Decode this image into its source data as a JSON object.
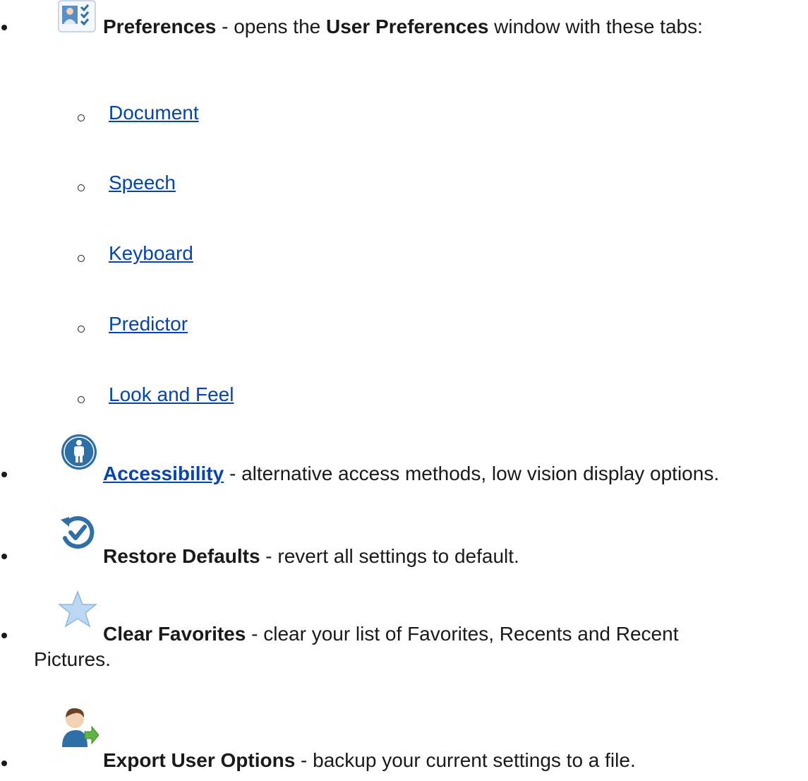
{
  "items": [
    {
      "icon": "preferences-icon",
      "title": "Preferences",
      "sep": " - ",
      "desc_pre": "opens the ",
      "desc_bold": "User Preferences",
      "desc_post": " window with these tabs:",
      "tabs": [
        "Document",
        "Speech",
        "Keyboard",
        "Predictor",
        "Look and Feel"
      ]
    },
    {
      "icon": "accessibility-icon",
      "title": "Accessibility",
      "sep": " - ",
      "desc": "alternative access methods, low vision display options."
    },
    {
      "icon": "restore-icon",
      "title": "Restore Defaults",
      "sep": " - ",
      "desc": "revert all settings to default."
    },
    {
      "icon": "star-icon",
      "title": "Clear Favorites",
      "sep": " - ",
      "desc": "clear your list of Favorites, Recents and Recent",
      "desc_cont": "Pictures."
    },
    {
      "icon": "export-user-icon",
      "title": "Export User Options",
      "sep": " - ",
      "desc": "backup your current settings to a file."
    }
  ],
  "colors": {
    "link": "#0645ad",
    "icon_blue": "#2f6fa8",
    "star": "#bcd8f2"
  }
}
